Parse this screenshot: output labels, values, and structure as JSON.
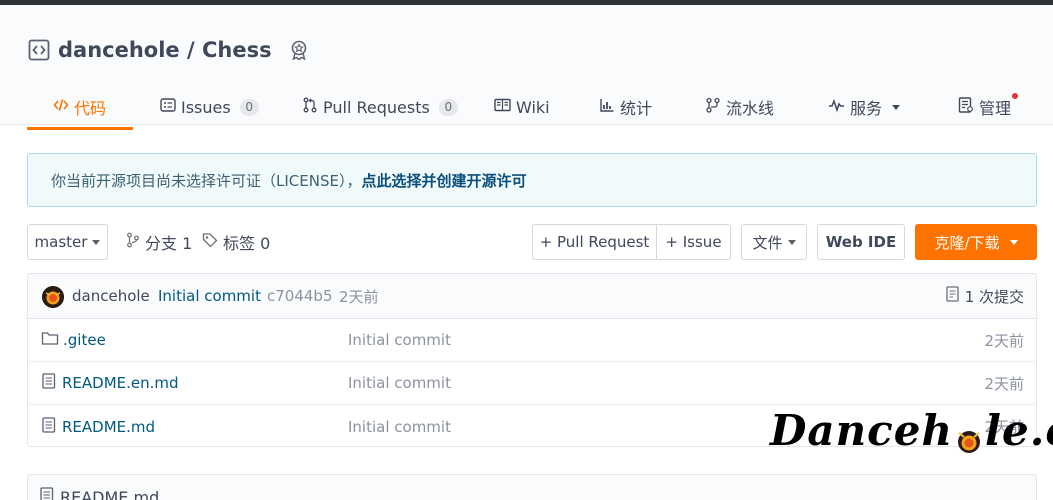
{
  "repo": {
    "owner": "dancehole",
    "separator": " / ",
    "name": "Chess"
  },
  "tabs": [
    {
      "label": "代码",
      "icon": "code-icon",
      "active": true
    },
    {
      "label": "Issues",
      "badge": "0",
      "icon": "issues-icon"
    },
    {
      "label": "Pull Requests",
      "badge": "0",
      "icon": "pull-request-icon"
    },
    {
      "label": "Wiki",
      "icon": "book-icon"
    },
    {
      "label": "统计",
      "icon": "bar-chart-icon"
    },
    {
      "label": "流水线",
      "icon": "pipeline-icon"
    },
    {
      "label": "服务",
      "icon": "pulse-icon",
      "dropdown": true
    },
    {
      "label": "管理",
      "icon": "settings-doc-icon",
      "notification_dot": true
    }
  ],
  "license_notice": {
    "text": "你当前开源项目尚未选择许可证（LICENSE），",
    "link": "点此选择并创建开源许可"
  },
  "toolbar": {
    "branch": "master",
    "branches_label": "分支 1",
    "tags_label": "标签 0",
    "new_pull_request": "+ Pull Request",
    "new_issue": "+ Issue",
    "files_menu": "文件",
    "web_ide": "Web IDE",
    "clone_download": "克隆/下载"
  },
  "latest_commit": {
    "author": "dancehole",
    "message": "Initial commit",
    "hash": "c7044b5",
    "time": "2天前",
    "commit_count": "1 次提交"
  },
  "files": [
    {
      "name": ".gitee",
      "type": "folder",
      "icon": "folder-icon",
      "commit": "Initial commit",
      "time": "2天前"
    },
    {
      "name": "README.en.md",
      "type": "file",
      "icon": "file-icon",
      "commit": "Initial commit",
      "time": "2天前"
    },
    {
      "name": "README.md",
      "type": "file",
      "icon": "file-icon",
      "commit": "Initial commit",
      "time": "2天前"
    }
  ],
  "readme": {
    "title": "README.md"
  },
  "watermark": {
    "text_before": "Danceh",
    "text_after": "le.cn"
  },
  "colors": {
    "accent": "#fe7300",
    "link": "#005980",
    "license_link": "#0b4f7a",
    "notification": "#e03535"
  }
}
